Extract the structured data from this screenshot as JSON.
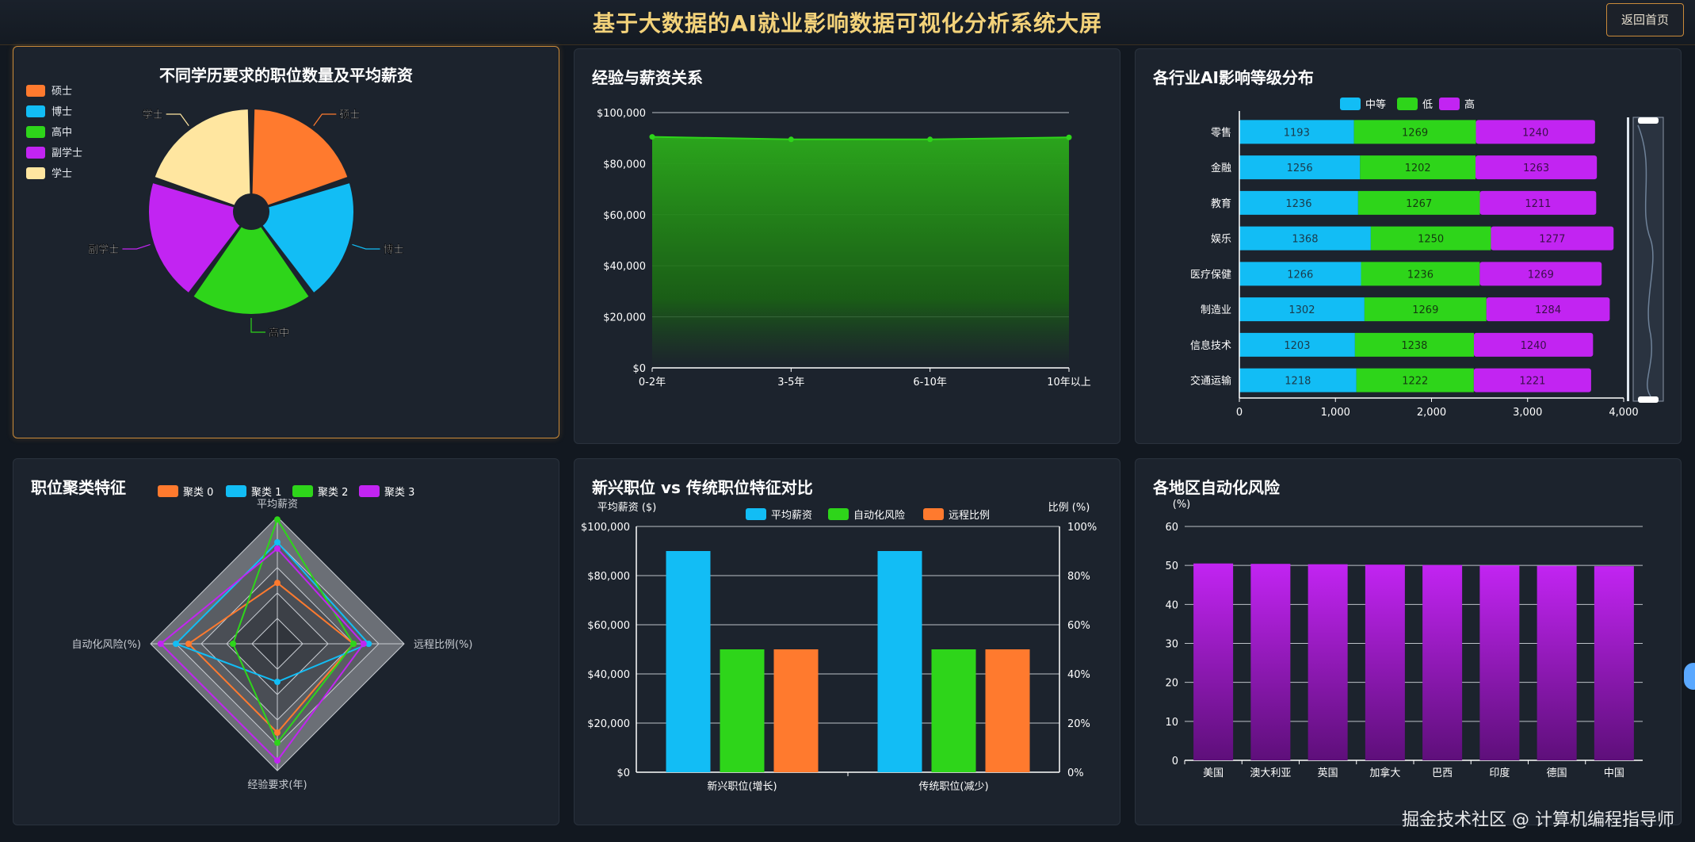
{
  "header": {
    "title": "基于大数据的AI就业影响数据可视化分析系统大屏",
    "back_label": "返回首页"
  },
  "watermark": "掘金技术社区 @ 计算机编程指导师",
  "panels": {
    "edu": "不同学历要求的职位数量及平均薪资",
    "exp": "经验与薪资关系",
    "industry": "各行业AI影响等级分布",
    "cluster": "职位聚类特征",
    "compare": "新兴职位 vs 传统职位特征对比",
    "region": "各地区自动化风险"
  },
  "chart_data": [
    {
      "id": "edu",
      "type": "pie",
      "title": "不同学历要求的职位数量及平均薪资",
      "legend_position": "top-left",
      "categories": [
        "硕士",
        "博士",
        "高中",
        "副学士",
        "学士"
      ],
      "values": [
        20,
        20,
        20,
        20,
        20
      ],
      "colors": [
        "#ff7a2e",
        "#12bdf5",
        "#2ed51a",
        "#c224f2",
        "#ffe6a0"
      ]
    },
    {
      "id": "exp",
      "type": "area",
      "title": "经验与薪资关系",
      "categories": [
        "0-2年",
        "3-5年",
        "6-10年",
        "10年以上"
      ],
      "values": [
        90500,
        89500,
        89500,
        90300
      ],
      "ylim": [
        0,
        100000
      ],
      "yticks": [
        "$0",
        "$20,000",
        "$40,000",
        "$60,000",
        "$80,000",
        "$100,000"
      ],
      "grid": true,
      "color": "#2ed51a"
    },
    {
      "id": "industry",
      "type": "bar",
      "orientation": "horizontal",
      "stacked": true,
      "title": "各行业AI影响等级分布",
      "legend_position": "top",
      "categories": [
        "零售",
        "金融",
        "教育",
        "娱乐",
        "医疗保健",
        "制造业",
        "信息技术",
        "交通运输"
      ],
      "series": [
        {
          "name": "中等",
          "color": "#12bdf5",
          "values": [
            1193,
            1256,
            1236,
            1368,
            1266,
            1302,
            1203,
            1218
          ]
        },
        {
          "name": "低",
          "color": "#2ed51a",
          "values": [
            1269,
            1202,
            1267,
            1250,
            1236,
            1269,
            1238,
            1222
          ]
        },
        {
          "name": "高",
          "color": "#c224f2",
          "values": [
            1240,
            1263,
            1211,
            1277,
            1269,
            1284,
            1240,
            1221
          ]
        }
      ],
      "xlim": [
        0,
        4000
      ],
      "xticks": [
        "0",
        "1,000",
        "2,000",
        "3,000",
        "4,000"
      ]
    },
    {
      "id": "cluster",
      "type": "radar",
      "title": "职位聚类特征",
      "legend_position": "top",
      "indicators": [
        "平均薪资",
        "远程比例(%)",
        "经验要求(年)",
        "自动化风险(%)"
      ],
      "series": [
        {
          "name": "聚类 0",
          "color": "#ff7a2e",
          "values": [
            0.48,
            0.6,
            0.7,
            0.7
          ]
        },
        {
          "name": "聚类 1",
          "color": "#12bdf5",
          "values": [
            0.8,
            0.72,
            0.3,
            0.8
          ]
        },
        {
          "name": "聚类 2",
          "color": "#2ed51a",
          "values": [
            0.98,
            0.6,
            0.78,
            0.35
          ]
        },
        {
          "name": "聚类 3",
          "color": "#c224f2",
          "values": [
            0.75,
            0.68,
            0.92,
            0.92
          ]
        }
      ]
    },
    {
      "id": "compare",
      "type": "bar",
      "title": "新兴职位 vs 传统职位特征对比",
      "legend_position": "top",
      "ylabel": "平均薪资 ($)",
      "ylabel_right": "比例 (%)",
      "categories": [
        "新兴职位(增长)",
        "传统职位(减少)"
      ],
      "series": [
        {
          "name": "平均薪资",
          "color": "#12bdf5",
          "axis": "left",
          "values": [
            90000,
            90000
          ]
        },
        {
          "name": "自动化风险",
          "color": "#2ed51a",
          "axis": "right",
          "values": [
            50,
            50
          ]
        },
        {
          "name": "远程比例",
          "color": "#ff7a2e",
          "axis": "right",
          "values": [
            50,
            50
          ]
        }
      ],
      "ylim": [
        0,
        100000
      ],
      "ylim_right": [
        0,
        100
      ],
      "yticks": [
        "$0",
        "$20,000",
        "$40,000",
        "$60,000",
        "$80,000",
        "$100,000"
      ],
      "yticks_right": [
        "0%",
        "20%",
        "40%",
        "60%",
        "80%",
        "100%"
      ],
      "grid": true
    },
    {
      "id": "region",
      "type": "bar",
      "title": "各地区自动化风险",
      "ylabel": "(%)",
      "categories": [
        "美国",
        "澳大利亚",
        "英国",
        "加拿大",
        "巴西",
        "印度",
        "德国",
        "中国"
      ],
      "values": [
        50.5,
        50.4,
        50.3,
        50.2,
        50.1,
        50.0,
        49.9,
        49.8
      ],
      "ylim": [
        0,
        60
      ],
      "yticks": [
        "0",
        "10",
        "20",
        "30",
        "40",
        "50",
        "60"
      ],
      "grid": true,
      "color": "#c224f2"
    }
  ]
}
